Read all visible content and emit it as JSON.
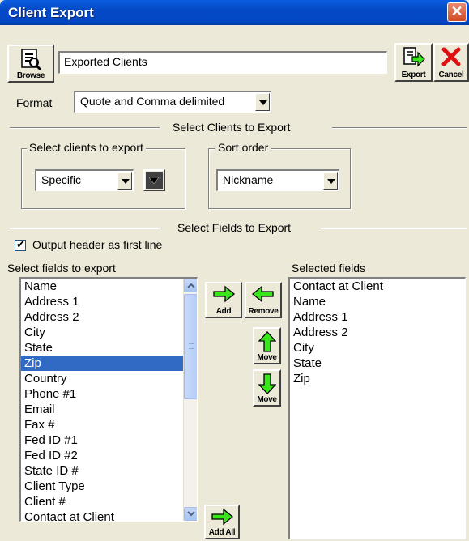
{
  "window": {
    "title": "Client Export",
    "close_glyph": "✕"
  },
  "toolbar": {
    "browse_label": "Browse",
    "export_label": "Export",
    "cancel_label": "Cancel",
    "filename_value": "Exported Clients"
  },
  "format": {
    "label": "Format",
    "value": "Quote and Comma delimited"
  },
  "select_clients": {
    "section_title": "Select Clients to Export",
    "group_label": "Select clients to export",
    "selection_value": "Specific",
    "sort_group_label": "Sort order",
    "sort_value": "Nickname"
  },
  "select_fields": {
    "section_title": "Select Fields to Export",
    "output_header_label": "Output header as first line",
    "output_header_checked": true,
    "available_label": "Select fields to export",
    "available_fields": [
      "Name",
      "Address 1",
      "Address 2",
      "City",
      "State",
      "Zip",
      "Country",
      "Phone #1",
      "Email",
      "Fax #",
      "Fed ID #1",
      "Fed ID #2",
      "State ID #",
      "Client Type",
      "Client #",
      "Contact at Client"
    ],
    "available_selected_index": 5,
    "selected_label": "Selected fields",
    "selected_fields": [
      "Contact at Client",
      "Name",
      "Address 1",
      "Address 2",
      "City",
      "State",
      "Zip"
    ],
    "buttons": {
      "add": "Add",
      "remove": "Remove",
      "move_up": "Move",
      "move_down": "Move",
      "add_all": "Add All"
    }
  },
  "colors": {
    "titlebar": "#0A5EE0",
    "selection": "#316AC5",
    "arrow_green": "#39E61A",
    "face": "#ECE9D8"
  }
}
